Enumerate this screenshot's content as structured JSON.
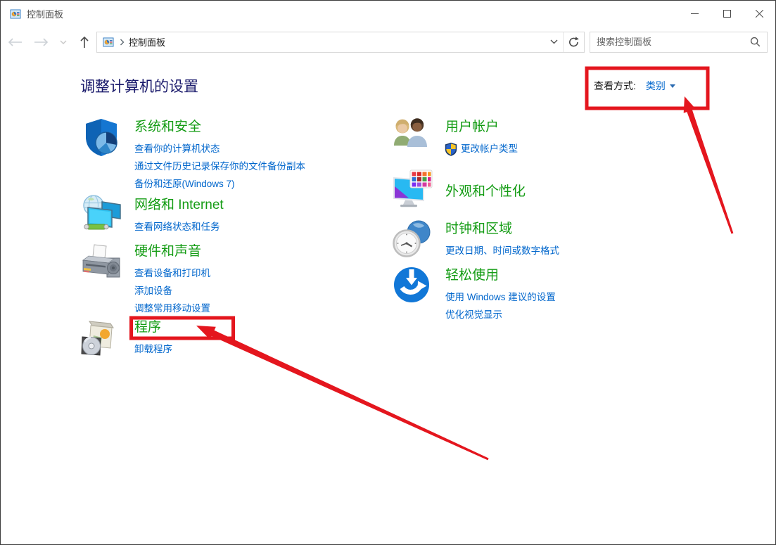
{
  "window": {
    "title": "控制面板"
  },
  "navbar": {
    "breadcrumb_root": "控制面板",
    "search_placeholder": "搜索控制面板"
  },
  "main": {
    "heading": "调整计算机的设置",
    "view_by_label": "查看方式:",
    "view_by_value": "类别"
  },
  "categories": {
    "left": [
      {
        "title": "系统和安全",
        "icon": "shield-pie-icon",
        "links": [
          "查看你的计算机状态",
          "通过文件历史记录保存你的文件备份副本",
          "备份和还原(Windows 7)"
        ]
      },
      {
        "title": "网络和 Internet",
        "icon": "globe-monitors-icon",
        "links": [
          "查看网络状态和任务"
        ]
      },
      {
        "title": "硬件和声音",
        "icon": "printer-speaker-icon",
        "links": [
          "查看设备和打印机",
          "添加设备",
          "调整常用移动设置"
        ]
      },
      {
        "title": "程序",
        "icon": "software-box-cd-icon",
        "highlighted": true,
        "links": [
          "卸载程序"
        ]
      }
    ],
    "right": [
      {
        "title": "用户帐户",
        "icon": "two-users-icon",
        "link_has_uac_shield": true,
        "links": [
          "更改帐户类型"
        ]
      },
      {
        "title": "外观和个性化",
        "icon": "monitor-palette-icon",
        "links": []
      },
      {
        "title": "时钟和区域",
        "icon": "clock-globe-icon",
        "links": [
          "更改日期、时间或数字格式"
        ]
      },
      {
        "title": "轻松使用",
        "icon": "ease-of-access-icon",
        "links": [
          "使用 Windows 建议的设置",
          "优化视觉显示"
        ]
      }
    ]
  },
  "colors": {
    "category_green": "#149c14",
    "task_link_blue": "#0066cc",
    "heading_navy": "#19196b",
    "annotation_red": "#e4161e"
  }
}
